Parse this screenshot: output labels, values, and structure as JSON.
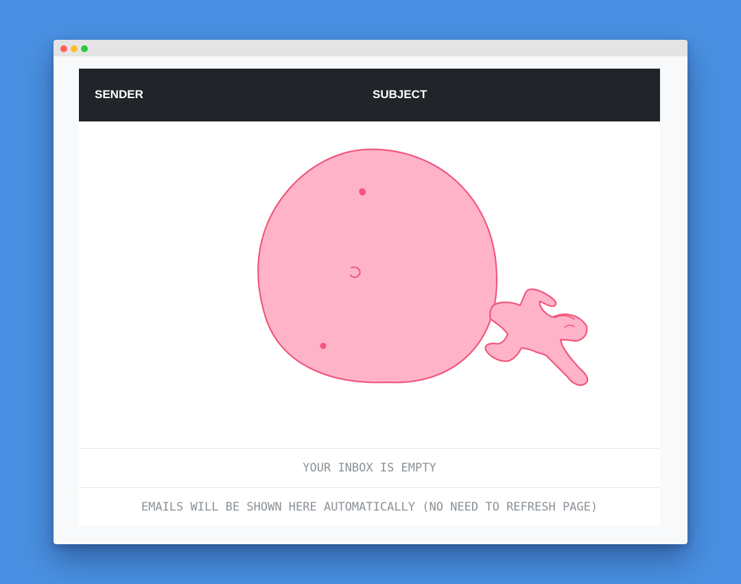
{
  "inbox": {
    "columns": {
      "sender": "SENDER",
      "subject": "SUBJECT"
    },
    "empty_message": "YOUR INBOX IS EMPTY",
    "auto_refresh_note": "EMAILS WILL BE SHOWN HERE AUTOMATICALLY (NO NEED TO REFRESH PAGE)"
  },
  "colors": {
    "background": "#4a90e2",
    "header": "#212529",
    "illustration_fill": "#ffb3c8",
    "illustration_stroke": "#f0577c"
  },
  "illustration": {
    "icon": "empty-inbox-ball-pusher-illustration"
  }
}
